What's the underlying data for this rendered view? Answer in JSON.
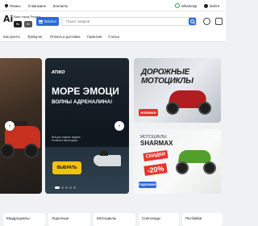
{
  "topbar": {
    "city": "Рязань",
    "links": [
      "О магазине",
      "Контакты"
    ],
    "whatsapp": "WhatsApp",
    "login": "Войти"
  },
  "header": {
    "logo": "Ai",
    "logo_sub": "",
    "city_label": "Ваш город Рязань",
    "lang_on": "Ru",
    "lang_off": "En",
    "catalog_label": "Каталог",
    "search_placeholder": "Поиск товаров"
  },
  "nav": {
    "items": [
      "Как купить",
      "Трейд-ин",
      "Оплата и доставка",
      "Гарантия",
      "Статьи"
    ]
  },
  "hero": {
    "brand": "ATIKO",
    "headline": "МОРЕ ЭМОЦИ",
    "subheadline": "ВОЛНЫ АДРЕНАЛИНА!",
    "promo": "Всё для отдыха: водная техника и аксессуары",
    "cta": "ВЫБРАТЬ",
    "prev_icon": "chevron-left",
    "next_icon": "chevron-right"
  },
  "promo_top": {
    "title": "ДОРОЖНЫЕ МОТОЦИКЛЫ",
    "badge": "НОВИНКИ"
  },
  "promo_bottom": {
    "label": "МОТОЦИКЛЫ",
    "brand": "SHARMAX",
    "sale": "СКИДКИ",
    "discount": "-20%",
    "badge": "ПОДРОБНЕЕ"
  },
  "categories": [
    "Квадроциклы",
    "Лодочные",
    "Мотоциклы",
    "Снегоходы",
    "Питбайки"
  ],
  "colors": {
    "accent": "#2e6ad8",
    "cta": "#f4c20d",
    "sale": "#e8322c"
  }
}
